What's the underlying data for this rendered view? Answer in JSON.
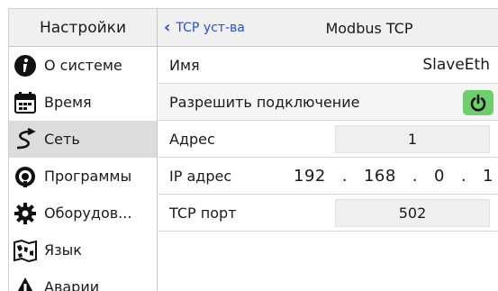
{
  "header": {
    "section_title": "Настройки",
    "back_label": "TCP уст-ва",
    "page_title": "Modbus TCP"
  },
  "sidebar": {
    "items": [
      {
        "label": "О системе",
        "icon": "info-icon",
        "active": false
      },
      {
        "label": "Время",
        "icon": "calendar-icon",
        "active": false
      },
      {
        "label": "Сеть",
        "icon": "network-icon",
        "active": true
      },
      {
        "label": "Программы",
        "icon": "program-icon",
        "active": false
      },
      {
        "label": "Оборудов...",
        "icon": "gear-icon",
        "active": false
      },
      {
        "label": "Язык",
        "icon": "map-icon",
        "active": false
      },
      {
        "label": "Аварии",
        "icon": "warning-icon",
        "active": false
      }
    ]
  },
  "settings": {
    "name_label": "Имя",
    "name_value": "SlaveEth",
    "allow_label": "Разрешить подключение",
    "allow_enabled": true,
    "address_label": "Адрес",
    "address_value": "1",
    "ip_label": "IP адрес",
    "ip_octets": [
      "192",
      "168",
      "0",
      "1"
    ],
    "ip_sep": ".",
    "port_label": "TCP порт",
    "port_value": "502"
  },
  "colors": {
    "accent": "#1f4fe0",
    "toggle_on": "#6ccf6a",
    "active_row": "#dcdcdc"
  }
}
